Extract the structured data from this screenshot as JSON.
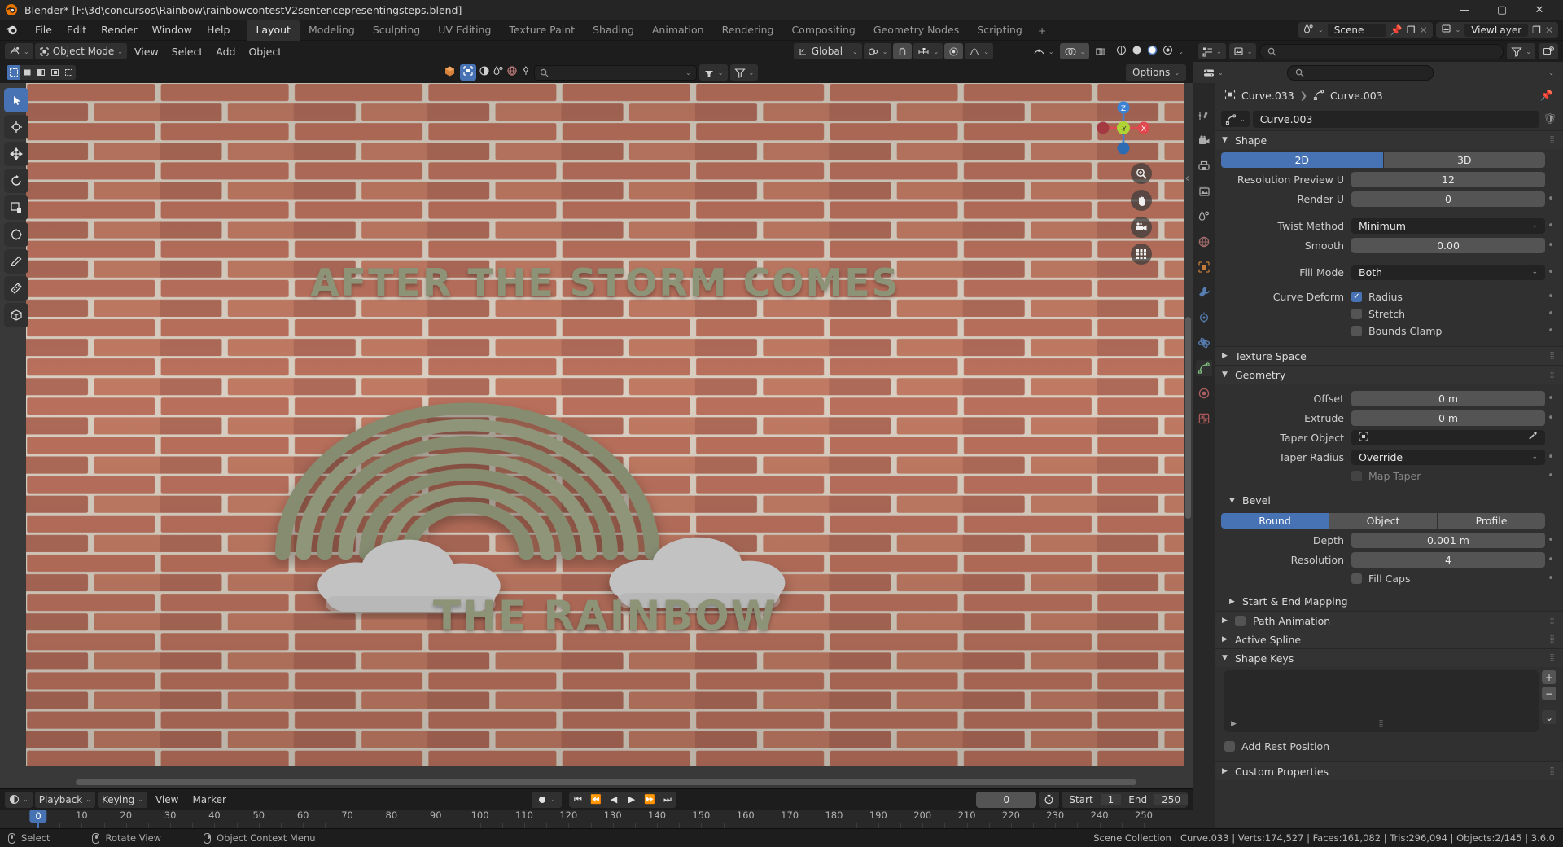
{
  "window": {
    "title": "Blender* [F:\\3d\\concursos\\Rainbow\\rainbowcontestV2sentencepresentingsteps.blend]",
    "minimize": "—",
    "maximize": "▢",
    "close": "✕"
  },
  "topbar": {
    "menus": [
      "File",
      "Edit",
      "Render",
      "Window",
      "Help"
    ],
    "workspaces": [
      "Layout",
      "Modeling",
      "Sculpting",
      "UV Editing",
      "Texture Paint",
      "Shading",
      "Animation",
      "Rendering",
      "Compositing",
      "Geometry Nodes",
      "Scripting"
    ],
    "add_workspace": "+",
    "active_workspace": "Layout",
    "scene_label": "Scene",
    "viewlayer_label": "ViewLayer"
  },
  "viewport_header": {
    "mode": "Object Mode",
    "menus": [
      "View",
      "Select",
      "Add",
      "Object"
    ],
    "transform_orientation": "Global",
    "options_label": "Options",
    "search_placeholder": ""
  },
  "artwork": {
    "line1": "AFTER THE STORM COMES",
    "line2": "THE RAINBOW",
    "text_color": "#8d9377",
    "rainbow_color": "#8a9075",
    "cloud_color": "#bdbdbd"
  },
  "timeline": {
    "editor_menus": [
      "Playback",
      "Keying",
      "View",
      "Marker"
    ],
    "current_frame": "0",
    "start_label": "Start",
    "start_value": "1",
    "end_label": "End",
    "end_value": "250",
    "playhead_label": "0",
    "ticks": [
      "0",
      "10",
      "20",
      "30",
      "40",
      "50",
      "60",
      "70",
      "80",
      "90",
      "100",
      "110",
      "120",
      "130",
      "140",
      "150",
      "160",
      "170",
      "180",
      "190",
      "200",
      "210",
      "220",
      "230",
      "240",
      "250"
    ]
  },
  "properties": {
    "breadcrumb": [
      "Curve.033",
      "Curve.003"
    ],
    "id_name": "Curve.003",
    "search_placeholder": "",
    "panels": {
      "shape": {
        "title": "Shape",
        "dimension_options": [
          "2D",
          "3D"
        ],
        "dimension_active": "2D",
        "rows": [
          {
            "label": "Resolution Preview U",
            "value": "12",
            "dot": false
          },
          {
            "label": "Render U",
            "value": "0",
            "dot": true
          }
        ],
        "twist_method_label": "Twist Method",
        "twist_method_value": "Minimum",
        "smooth_label": "Smooth",
        "smooth_value": "0.00",
        "fill_mode_label": "Fill Mode",
        "fill_mode_value": "Both",
        "curve_deform_label": "Curve Deform",
        "checkboxes": [
          {
            "label": "Radius",
            "checked": true
          },
          {
            "label": "Stretch",
            "checked": false
          },
          {
            "label": "Bounds Clamp",
            "checked": false
          }
        ]
      },
      "texture_space": {
        "title": "Texture Space"
      },
      "geometry": {
        "title": "Geometry",
        "offset_label": "Offset",
        "offset_value": "0 m",
        "extrude_label": "Extrude",
        "extrude_value": "0 m",
        "taper_object_label": "Taper Object",
        "taper_object_value": "",
        "taper_radius_label": "Taper Radius",
        "taper_radius_value": "Override",
        "map_taper_label": "Map Taper",
        "map_taper_checked": false
      },
      "bevel": {
        "title": "Bevel",
        "type_options": [
          "Round",
          "Object",
          "Profile"
        ],
        "type_active": "Round",
        "depth_label": "Depth",
        "depth_value": "0.001 m",
        "resolution_label": "Resolution",
        "resolution_value": "4",
        "fill_caps_label": "Fill Caps",
        "fill_caps_checked": false,
        "start_end_mapping": "Start & End Mapping"
      },
      "path_animation": {
        "title": "Path Animation",
        "checked": false
      },
      "active_spline": {
        "title": "Active Spline"
      },
      "shape_keys": {
        "title": "Shape Keys",
        "add_rest_position_label": "Add Rest Position",
        "add_rest_position_checked": false,
        "add_button": "+",
        "remove_button": "−",
        "menu_button": "⌄"
      },
      "custom_properties": {
        "title": "Custom Properties"
      }
    }
  },
  "statusbar": {
    "left_items": [
      {
        "icon": "mouse-left",
        "label": "Select"
      },
      {
        "icon": "mouse-middle",
        "label": "Rotate View"
      },
      {
        "icon": "mouse-right",
        "label": "Object Context Menu"
      }
    ],
    "right_text": "Scene Collection | Curve.033 | Verts:174,527 | Faces:161,082 | Tris:296,094 | Objects:2/145 | 3.6.0"
  },
  "colors": {
    "accent_blue": "#4772b3",
    "panel_bg": "#303030",
    "header_bg": "#1d1d1d",
    "field_bg": "#545454",
    "axis_x": "#e0484f",
    "axis_y": "#b0d435",
    "axis_z": "#3b82d4"
  }
}
